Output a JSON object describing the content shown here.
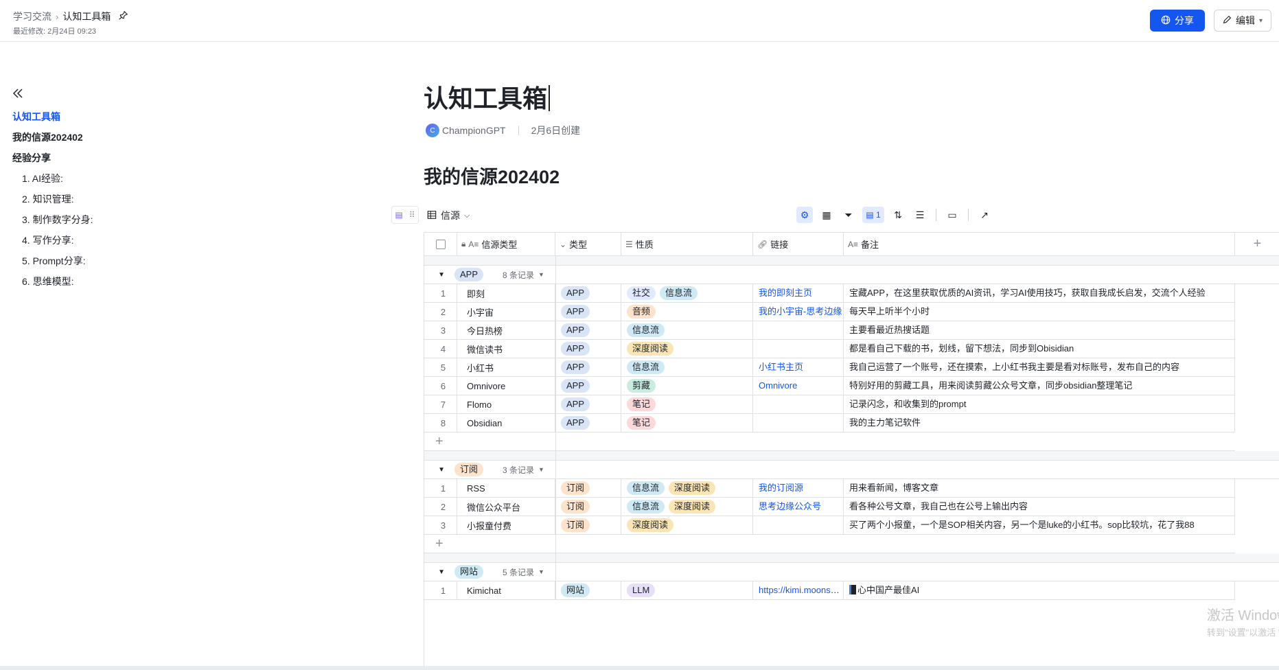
{
  "breadcrumb": {
    "parent": "学习交流",
    "current": "认知工具箱"
  },
  "last_modified": "最近修改: 2月24日 09:23",
  "actions": {
    "share": "分享",
    "edit": "编辑"
  },
  "outline": {
    "title": "认知工具箱",
    "h2_a": "我的信源202402",
    "h2_b": "经验分享",
    "subs": [
      "1. AI经验:",
      "2. 知识管理:",
      "3. 制作数字分身:",
      "4. 写作分享:",
      "5. Prompt分享:",
      "6. 思维模型:"
    ]
  },
  "doc": {
    "title": "认知工具箱",
    "author_initial": "C",
    "author": "ChampionGPT",
    "created": "2月6日创建",
    "section_title": "我的信源202402"
  },
  "view": {
    "name": "信源",
    "row_height_count": "1"
  },
  "columns": [
    "信源类型",
    "类型",
    "性质",
    "链接",
    "备注"
  ],
  "groups": [
    {
      "name": "APP",
      "count": "8 条记录",
      "rows": [
        {
          "n": "1",
          "name": "即刻",
          "type": "APP",
          "tags": [
            "社交",
            "信息流"
          ],
          "link": "我的即刻主页",
          "note": "宝藏APP，在这里获取优质的AI资讯，学习AI使用技巧，获取自我成长启发，交流个人经验"
        },
        {
          "n": "2",
          "name": "小宇宙",
          "type": "APP",
          "tags": [
            "音频"
          ],
          "link": "我的小宇宙-思考边缘",
          "note": "每天早上听半个小时"
        },
        {
          "n": "3",
          "name": "今日热榜",
          "type": "APP",
          "tags": [
            "信息流"
          ],
          "link": "",
          "note": "主要看最近热搜话题"
        },
        {
          "n": "4",
          "name": "微信读书",
          "type": "APP",
          "tags": [
            "深度阅读"
          ],
          "link": "",
          "note": "都是看自己下载的书，划线，留下想法，同步到Obisidian"
        },
        {
          "n": "5",
          "name": "小红书",
          "type": "APP",
          "tags": [
            "信息流"
          ],
          "link": "小红书主页",
          "note": "我自己运营了一个账号，还在摸索，上小红书我主要是看对标账号，发布自己的内容"
        },
        {
          "n": "6",
          "name": "Omnivore",
          "type": "APP",
          "tags": [
            "剪藏"
          ],
          "link": "Omnivore",
          "note": "特别好用的剪藏工具，用来阅读剪藏公众号文章，同步obsidian整理笔记"
        },
        {
          "n": "7",
          "name": "Flomo",
          "type": "APP",
          "tags": [
            "笔记"
          ],
          "link": "",
          "note": "记录闪念，和收集到的prompt"
        },
        {
          "n": "8",
          "name": "Obsidian",
          "type": "APP",
          "tags": [
            "笔记"
          ],
          "link": "",
          "note": "我的主力笔记软件"
        }
      ]
    },
    {
      "name": "订阅",
      "count": "3 条记录",
      "rows": [
        {
          "n": "1",
          "name": "RSS",
          "type": "订阅",
          "tags": [
            "信息流",
            "深度阅读"
          ],
          "link": "我的订阅源",
          "note": "用来看新闻，博客文章"
        },
        {
          "n": "2",
          "name": "微信公众平台",
          "type": "订阅",
          "tags": [
            "信息流",
            "深度阅读"
          ],
          "link": "思考边缘公众号",
          "note": "看各种公号文章，我自己也在公号上输出内容"
        },
        {
          "n": "3",
          "name": "小报童付费",
          "type": "订阅",
          "tags": [
            "深度阅读"
          ],
          "link": "",
          "note": "买了两个小报童，一个是SOP相关内容，另一个是luke的小红书。sop比较坑，花了我88"
        }
      ]
    },
    {
      "name": "网站",
      "count": "5 条记录",
      "rows": [
        {
          "n": "1",
          "name": "Kimichat",
          "type": "网站",
          "tags": [
            "LLM"
          ],
          "link": "https://kimi.moonshot.cn",
          "note": "心中国产最佳AI"
        }
      ]
    }
  ],
  "watermark": {
    "line1": "激活 Windows",
    "line2": "转到\"设置\"以激活 Windows。"
  },
  "icons": {
    "share": "globe-icon",
    "edit": "pencil-icon",
    "pin": "pin-icon",
    "collapse": "double-chevron-left-icon"
  },
  "colors": {
    "accent": "#1456f0",
    "tag_app": "#d9e4f7",
    "tag_sub": "#fde2cc",
    "tag_web": "#cfeaf5"
  }
}
